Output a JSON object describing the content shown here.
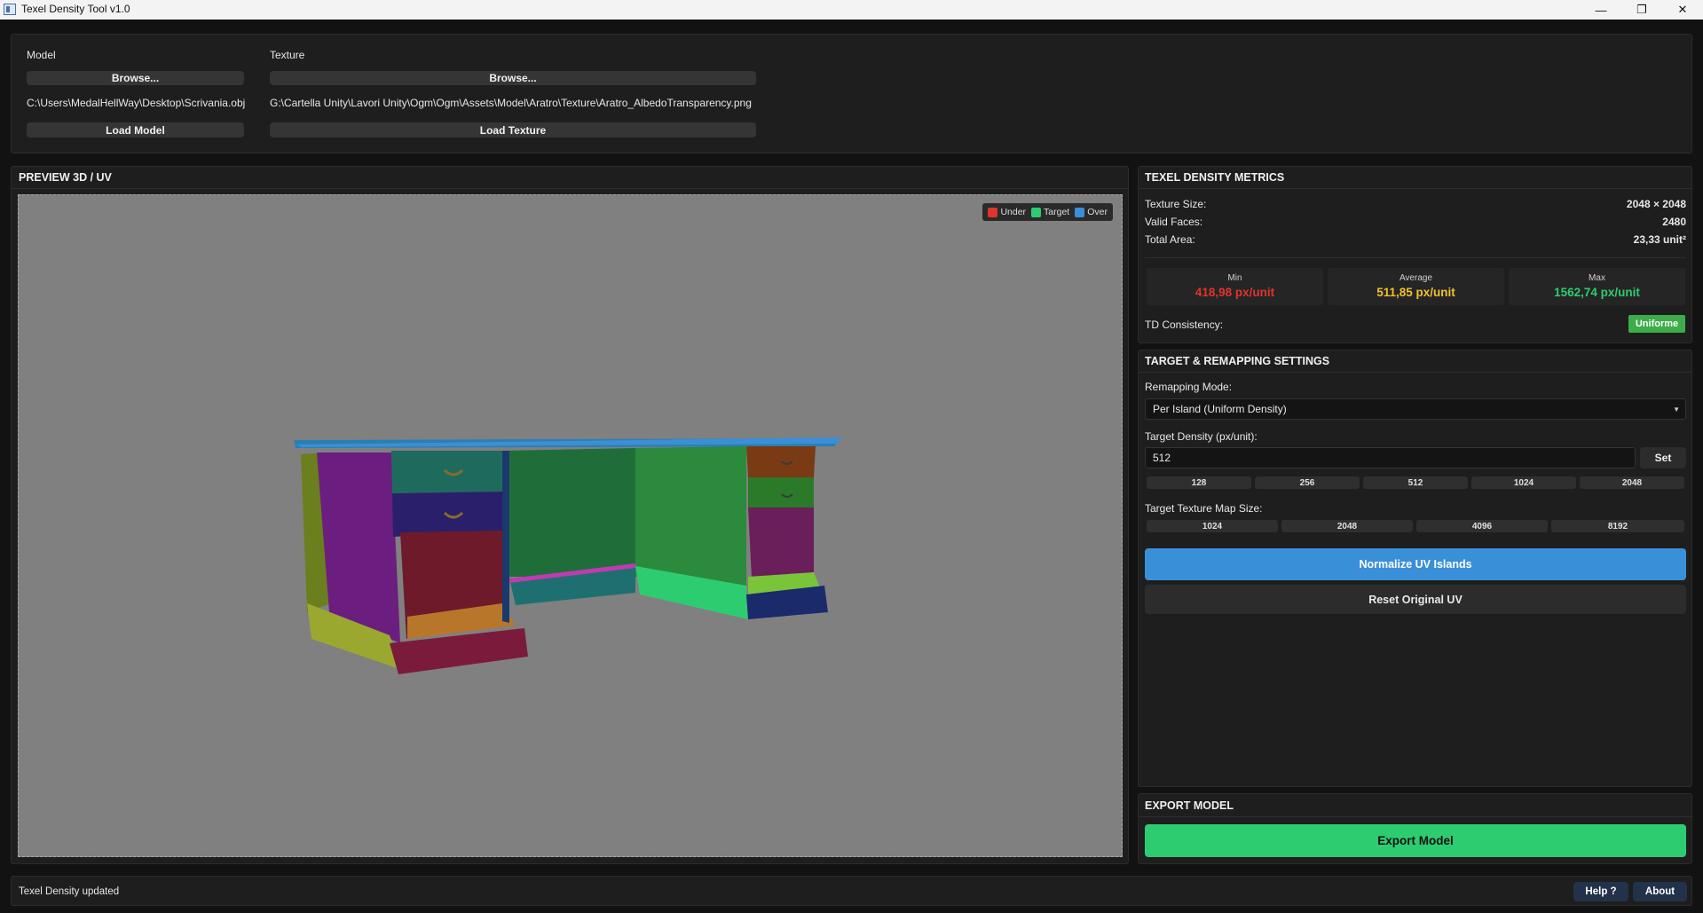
{
  "window": {
    "title": "Texel Density Tool v1.0",
    "controls": [
      "—",
      "❐",
      "✕"
    ]
  },
  "files": {
    "model_label": "Model",
    "texture_label": "Texture",
    "browse_label": "Browse...",
    "model_path": "C:\\Users\\MedalHellWay\\Desktop\\Scrivania.obj",
    "texture_path": "G:\\Cartella Unity\\Lavori Unity\\Ogm\\Ogm\\Assets\\Model\\Aratro\\Texture\\Aratro_AlbedoTransparency.png",
    "load_model_label": "Load Model",
    "load_texture_label": "Load Texture"
  },
  "preview": {
    "title": "PREVIEW 3D / UV",
    "legend": [
      {
        "label": "Under",
        "color": "#e0342c"
      },
      {
        "label": "Target",
        "color": "#2ecc71"
      },
      {
        "label": "Over",
        "color": "#3a8fd9"
      }
    ]
  },
  "metrics": {
    "title": "TEXEL DENSITY METRICS",
    "texture_size_label": "Texture Size:",
    "texture_size_value": "2048 × 2048",
    "valid_faces_label": "Valid Faces:",
    "valid_faces_value": "2480",
    "total_area_label": "Total Area:",
    "total_area_value": "23,33 unit²",
    "min_label": "Min",
    "min_value": "418,98 px/unit",
    "min_color": "#e0342c",
    "avg_label": "Average",
    "avg_value": "511,85 px/unit",
    "avg_color": "#f2c12e",
    "max_label": "Max",
    "max_value": "1562,74 px/unit",
    "max_color": "#2ecc71",
    "consistency_label": "TD Consistency:",
    "consistency_value": "Uniforme"
  },
  "settings": {
    "title": "TARGET & REMAPPING SETTINGS",
    "mode_label": "Remapping Mode:",
    "mode_value": "Per Island (Uniform Density)",
    "density_label": "Target Density (px/unit):",
    "density_value": "512",
    "set_label": "Set",
    "density_presets": [
      "128",
      "256",
      "512",
      "1024",
      "2048"
    ],
    "map_size_label": "Target Texture Map Size:",
    "map_sizes": [
      "1024",
      "2048",
      "4096",
      "8192"
    ],
    "normalize_label": "Normalize UV Islands",
    "reset_label": "Reset Original UV"
  },
  "export": {
    "title": "EXPORT MODEL",
    "button_label": "Export Model"
  },
  "statusbar": {
    "message": "Texel Density updated",
    "help_label": "Help ?",
    "about_label": "About"
  }
}
